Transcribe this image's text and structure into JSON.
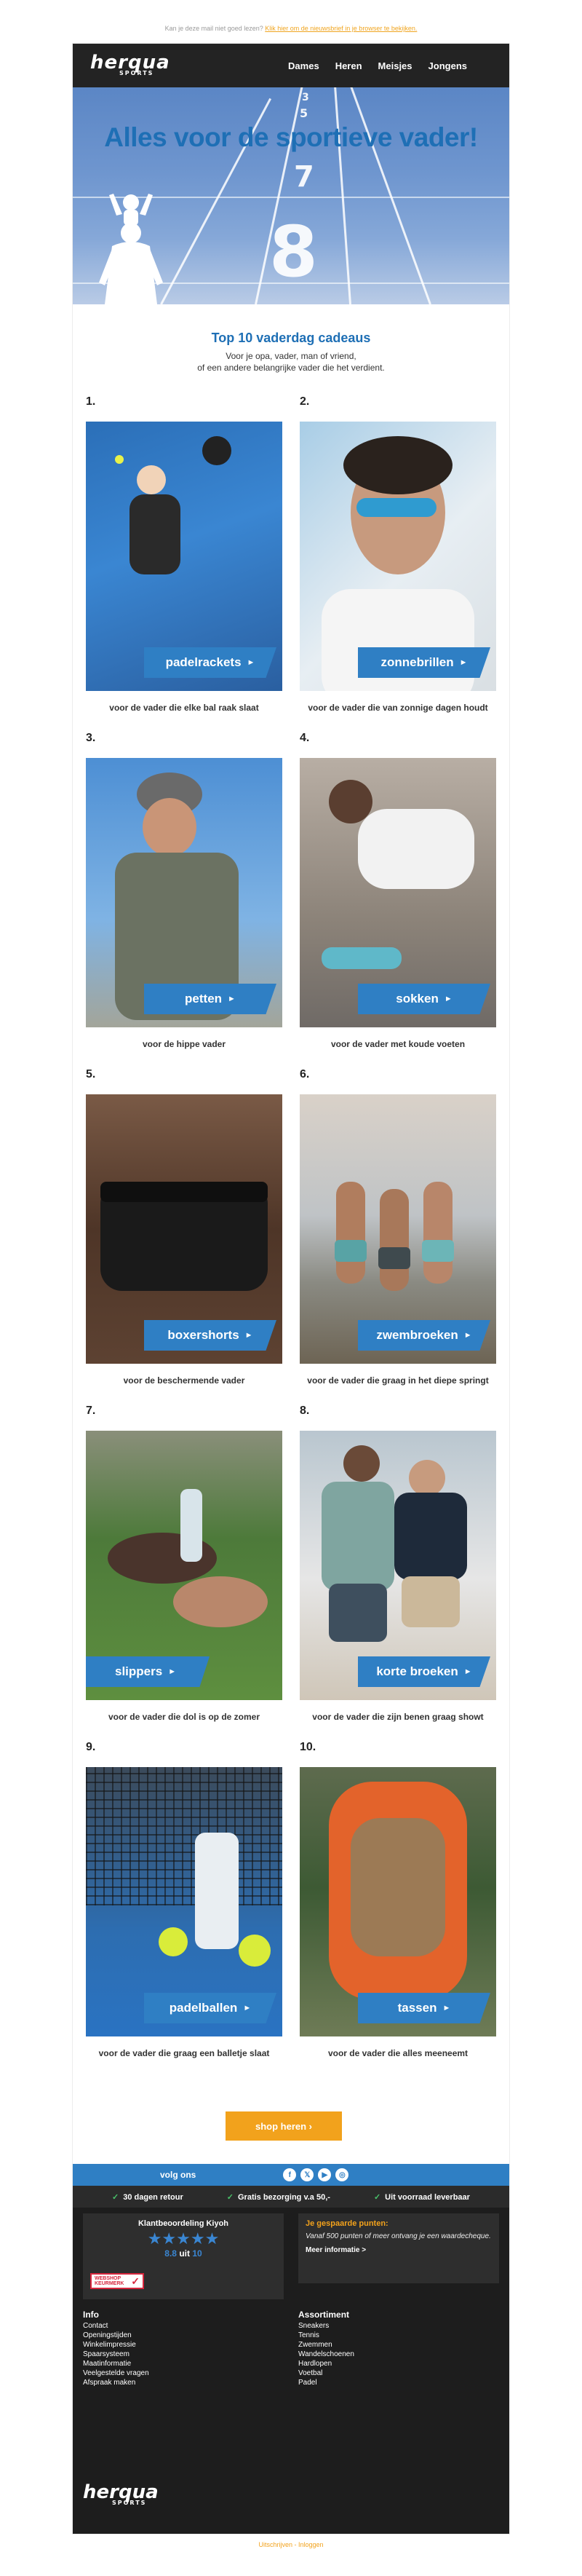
{
  "preheader": {
    "text": "Kan je deze mail niet goed lezen?",
    "link": "Klik hier om de nieuwsbrief in je browser te bekijken."
  },
  "header": {
    "logo": "herqua",
    "logo_sub": "SPORTS",
    "nav": [
      "Dames",
      "Heren",
      "Meisjes",
      "Jongens"
    ]
  },
  "hero": {
    "title": "Alles voor de sportieve vader!",
    "numbers": [
      "3",
      "5",
      "7",
      "8"
    ]
  },
  "intro": {
    "title": "Top 10 vaderdag cadeaus",
    "line1": "Voor je opa, vader, man of vriend,",
    "line2": "of een andere belangrijke vader die het verdient."
  },
  "products": [
    {
      "num": "1.",
      "label": "padelrackets",
      "caption": "voor de vader die elke bal raak slaat"
    },
    {
      "num": "2.",
      "label": "zonnebrillen",
      "caption": "voor de vader die van zonnige dagen houdt"
    },
    {
      "num": "3.",
      "label": "petten",
      "caption": "voor de hippe vader"
    },
    {
      "num": "4.",
      "label": "sokken",
      "caption": "voor de vader met koude voeten"
    },
    {
      "num": "5.",
      "label": "boxershorts",
      "caption": "voor de beschermende vader"
    },
    {
      "num": "6.",
      "label": "zwembroeken",
      "caption": "voor de vader die graag in het diepe springt"
    },
    {
      "num": "7.",
      "label": "slippers",
      "caption": "voor de vader die dol is op de zomer"
    },
    {
      "num": "8.",
      "label": "korte broeken",
      "caption": "voor de vader die zijn benen graag showt"
    },
    {
      "num": "9.",
      "label": "padelballen",
      "caption": "voor de vader die graag een balletje slaat"
    },
    {
      "num": "10.",
      "label": "tassen",
      "caption": "voor de vader die alles meeneemt"
    }
  ],
  "cta": {
    "label": "shop heren ›"
  },
  "social": {
    "label": "volg ons",
    "icons": [
      {
        "name": "facebook-icon",
        "glyph": "f"
      },
      {
        "name": "x-icon",
        "glyph": "𝕏"
      },
      {
        "name": "youtube-icon",
        "glyph": "▶"
      },
      {
        "name": "instagram-icon",
        "glyph": "◎"
      }
    ]
  },
  "usp": [
    "30 dagen retour",
    "Gratis bezorging v.a 50,-",
    "Uit voorraad leverbaar"
  ],
  "rating": {
    "title": "Klantbeoordeling Kiyoh",
    "stars": "★★★★★",
    "score": "8.8",
    "of": "uit",
    "max": "10",
    "keurmerk": "WEBSHOP KEURMERK"
  },
  "points": {
    "title": "Je gespaarde punten:",
    "text": "Vanaf 500 punten of meer ontvang je een waardecheque.",
    "link": "Meer informatie >"
  },
  "info": {
    "title": "Info",
    "links": [
      "Contact",
      "Openingstijden",
      "Winkelimpressie",
      "Spaarsysteem",
      "Maatinformatie",
      "Veelgestelde vragen",
      "Afspraak maken"
    ]
  },
  "assortiment": {
    "title": "Assortiment",
    "links": [
      "Sneakers",
      "Tennis",
      "Zwemmen",
      "Wandelschoenen",
      "Hardlopen",
      "Voetbal",
      "Padel"
    ]
  },
  "footer_logo": {
    "logo": "herqua",
    "sub": "SPORTS"
  },
  "bottom": {
    "link1": "Uitschrijven",
    "sep": "-",
    "link2": "Inloggen"
  },
  "colors": {
    "accent": "#2f7fc4",
    "cta": "#f2a21c",
    "dark": "#232323"
  }
}
